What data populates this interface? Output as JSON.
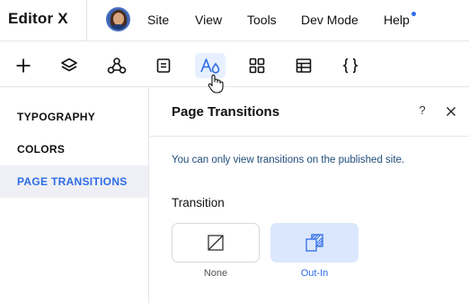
{
  "app": {
    "logo": "Editor X"
  },
  "menu": {
    "items": [
      {
        "label": "Site"
      },
      {
        "label": "View"
      },
      {
        "label": "Tools"
      },
      {
        "label": "Dev Mode"
      },
      {
        "label": "Help"
      }
    ]
  },
  "toolbar": {
    "tools": [
      {
        "icon": "plus-icon"
      },
      {
        "icon": "layers-icon"
      },
      {
        "icon": "connections-icon"
      },
      {
        "icon": "pages-icon"
      },
      {
        "icon": "design-icon",
        "active": true
      },
      {
        "icon": "apps-grid-icon"
      },
      {
        "icon": "table-icon"
      },
      {
        "icon": "code-braces-icon"
      }
    ]
  },
  "sidebar": {
    "items": [
      {
        "label": "TYPOGRAPHY"
      },
      {
        "label": "COLORS"
      },
      {
        "label": "PAGE TRANSITIONS",
        "selected": true
      }
    ]
  },
  "panel": {
    "title": "Page Transitions",
    "help_label": "?",
    "notice": "You can only view transitions on the published site.",
    "section_label": "Transition",
    "options": [
      {
        "label": "None",
        "icon": "none-transition-icon"
      },
      {
        "label": "Out-In",
        "icon": "out-in-transition-icon",
        "selected": true
      }
    ]
  },
  "colors": {
    "accent": "#2f6ce8",
    "selected_bg": "#e7f0ff",
    "nav_selected_bg": "#eef0f5",
    "notice_text": "#1f4b7a"
  }
}
